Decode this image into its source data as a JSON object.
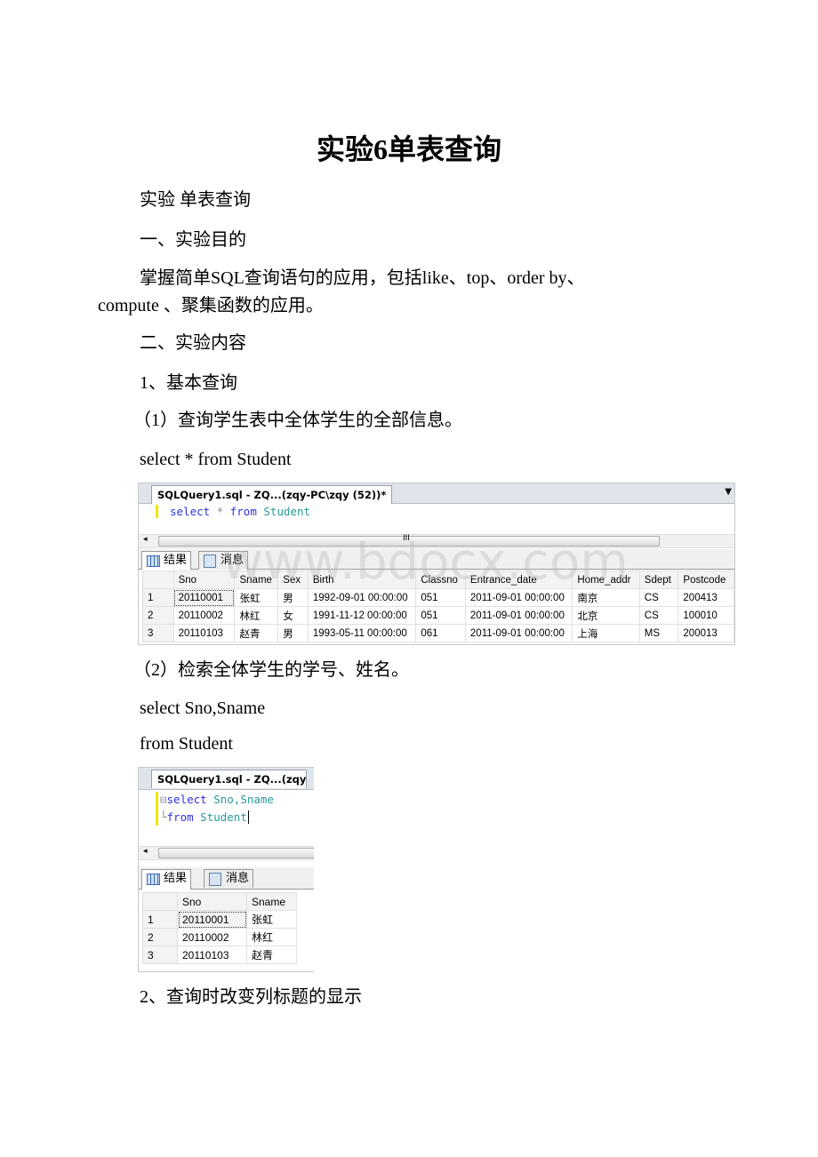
{
  "title": "实验6单表查询",
  "paragraphs": {
    "p1": "实验  单表查询",
    "p2": "一、实验目的",
    "p3a": "掌握简单SQL查询语句的应用，包括like、top、order by、",
    "p3b": "compute 、聚集函数的应用。",
    "p4": "二、实验内容",
    "p5": "1、基本查询",
    "p6": "（1）查询学生表中全体学生的全部信息。",
    "p7": "select * from Student",
    "p8": "（2）检索全体学生的学号、姓名。",
    "p9": "select Sno,Sname",
    "p10": "from Student",
    "p11": "2、查询时改变列标题的显示"
  },
  "watermark": "www.bdocx.com",
  "shot1": {
    "tab": "SQLQuery1.sql - ZQ...(zqy-PC\\zqy (52))*",
    "code": {
      "kw1": "select",
      "op": "*",
      "kw2": "from",
      "id": "Student"
    },
    "scroll_mark": "III",
    "tabs": [
      "结果",
      "消息"
    ],
    "columns": [
      "",
      "Sno",
      "Sname",
      "Sex",
      "Birth",
      "Classno",
      "Entrance_date",
      "Home_addr",
      "Sdept",
      "Postcode"
    ],
    "rows": [
      [
        "1",
        "20110001",
        "张虹",
        "男",
        "1992-09-01 00:00:00",
        "051",
        "2011-09-01 00:00:00",
        "南京",
        "CS",
        "200413"
      ],
      [
        "2",
        "20110002",
        "林红",
        "女",
        "1991-11-12 00:00:00",
        "051",
        "2011-09-01 00:00:00",
        "北京",
        "CS",
        "100010"
      ],
      [
        "3",
        "20110103",
        "赵青",
        "男",
        "1993-05-11 00:00:00",
        "061",
        "2011-09-01 00:00:00",
        "上海",
        "MS",
        "200013"
      ]
    ]
  },
  "shot2": {
    "tab": "SQLQuery1.sql - ZQ...(zqy",
    "code": {
      "kw1": "select",
      "id1": "Sno,Sname",
      "kw2": "from",
      "id2": "Student"
    },
    "tabs": [
      "结果",
      "消息"
    ],
    "columns": [
      "",
      "Sno",
      "Sname"
    ],
    "rows": [
      [
        "1",
        "20110001",
        "张虹"
      ],
      [
        "2",
        "20110002",
        "林红"
      ],
      [
        "3",
        "20110103",
        "赵青"
      ]
    ]
  }
}
